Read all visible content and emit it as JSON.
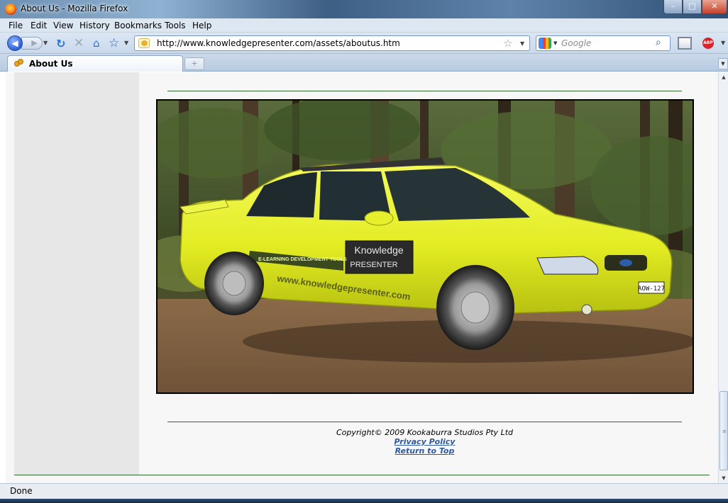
{
  "window": {
    "title": "About Us - Mozilla Firefox",
    "controls": {
      "minimize": "–",
      "maximize": "□",
      "close": "✕"
    }
  },
  "menu": [
    "File",
    "Edit",
    "View",
    "History",
    "Bookmarks",
    "Tools",
    "Help"
  ],
  "navbar": {
    "url": "http://www.knowledgepresenter.com/assets/aboutus.htm",
    "search_placeholder": "Google",
    "icons": [
      "back-icon",
      "forward-icon",
      "reload-icon",
      "stop-icon",
      "home-icon",
      "bookmark-star-icon",
      "site-icon",
      "google-icon",
      "search-icon",
      "window-icon",
      "adblock-icon"
    ]
  },
  "tabs": [
    {
      "label": "About Us",
      "active": true
    }
  ],
  "page": {
    "photo_sign": {
      "line1": "Knowledge",
      "line2": "PRESENTER",
      "stripe": "E-LEARNING DEVELOPMENT TOOLS",
      "website": "www.knowledgepresenter.com",
      "plate": "AOW-127"
    },
    "footer": {
      "copyright": "Copyright© 2009 Kookaburra Studios Pty Ltd",
      "privacy": "Privacy Policy",
      "top": "Return to Top"
    }
  },
  "status": "Done",
  "colors": {
    "rule": "#2f6a2f",
    "link": "#2f5a9f",
    "car": "#e6ef2a"
  }
}
